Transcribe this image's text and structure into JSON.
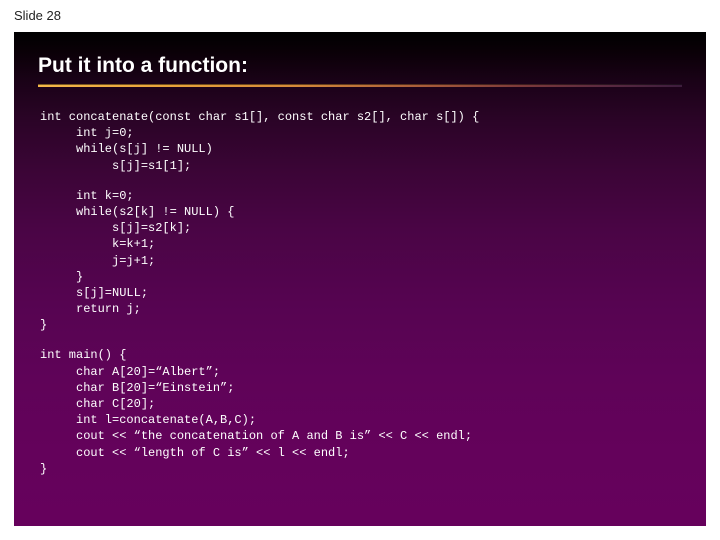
{
  "slide_label": "Slide 28",
  "title": "Put it into a function:",
  "code_block_1": "int concatenate(const char s1[], const char s2[], char s[]) {\n     int j=0;\n     while(s[j] != NULL)\n          s[j]=s1[1];",
  "code_block_2": "     int k=0;\n     while(s2[k] != NULL) {\n          s[j]=s2[k];\n          k=k+1;\n          j=j+1;\n     }\n     s[j]=NULL;\n     return j;\n}",
  "code_block_3": "int main() {\n     char A[20]=“Albert”;\n     char B[20]=“Einstein”;\n     char C[20];\n     int l=concatenate(A,B,C);\n     cout << “the concatenation of A and B is” << C << endl;\n     cout << “length of C is” << l << endl;\n}"
}
